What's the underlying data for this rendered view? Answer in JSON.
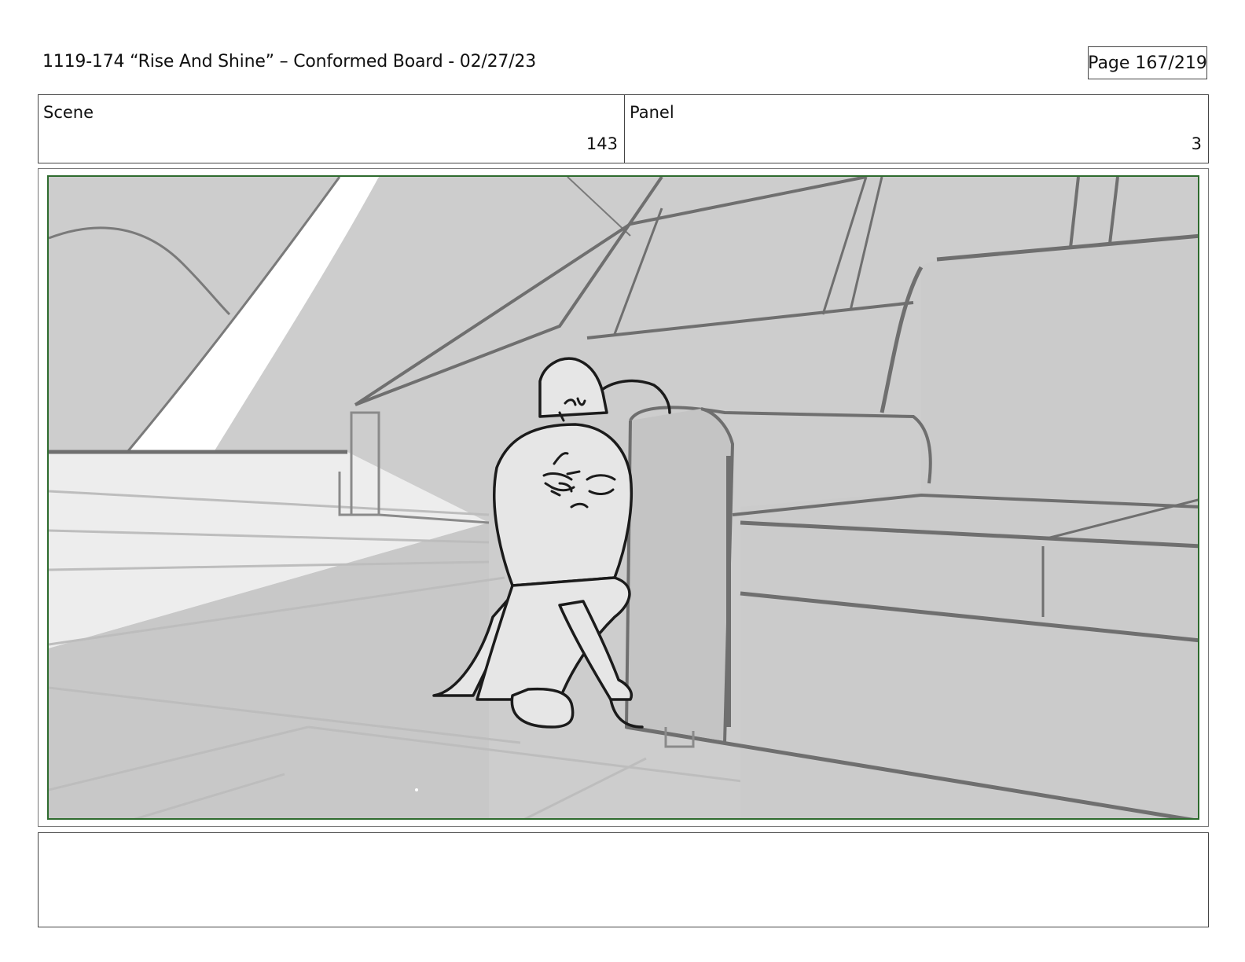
{
  "header": {
    "title": "1119-174 “Rise And Shine” – Conformed Board - 02/27/23",
    "page": "Page 167/219"
  },
  "info": {
    "scene_label": "Scene",
    "scene_value": "143",
    "panel_label": "Panel",
    "panel_value": "3"
  },
  "notes": {
    "text": ""
  }
}
